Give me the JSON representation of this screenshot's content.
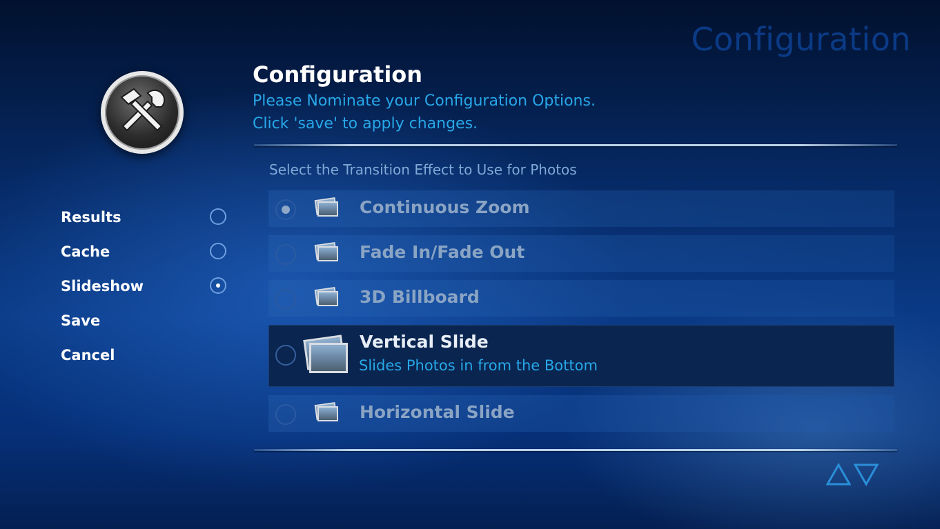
{
  "watermark": "Configuration",
  "header": {
    "title": "Configuration",
    "line1": "Please Nominate your Configuration Options.",
    "line2": "Click 'save' to apply changes."
  },
  "section_label": "Select the Transition Effect to Use for Photos",
  "nav": {
    "items": [
      {
        "label": "Results",
        "radio": true,
        "checked": false
      },
      {
        "label": "Cache",
        "radio": true,
        "checked": false
      },
      {
        "label": "Slideshow",
        "radio": true,
        "checked": true
      },
      {
        "label": "Save",
        "radio": false
      },
      {
        "label": "Cancel",
        "radio": false
      }
    ]
  },
  "options": [
    {
      "label": "Continuous Zoom",
      "checked": true
    },
    {
      "label": "Fade In/Fade Out",
      "checked": false
    },
    {
      "label": "3D Billboard",
      "checked": false
    },
    {
      "label": "Vertical Slide",
      "checked": false,
      "focused": true,
      "description": "Slides Photos in from the Bottom"
    },
    {
      "label": "Horizontal Slide",
      "checked": false
    }
  ],
  "colors": {
    "accent_text": "#27a8e8",
    "title_text": "#ffffff",
    "focused_row": "#0a2550"
  },
  "icons": {
    "logo": "tools-icon",
    "option_thumb": "photo-stack-icon",
    "scroll_up": "triangle-up-icon",
    "scroll_down": "triangle-down-icon"
  }
}
